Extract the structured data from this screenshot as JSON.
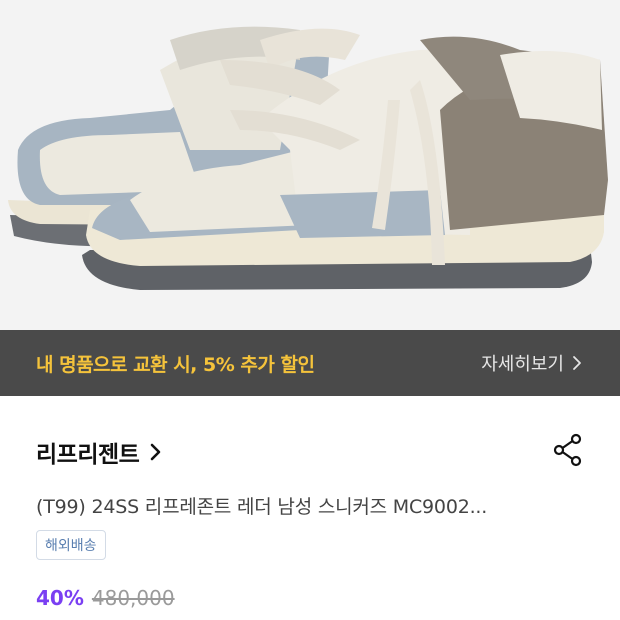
{
  "promo": {
    "text": "내 명품으로 교환 시, 5% 추가 할인",
    "more_label": "자세히보기",
    "text_color": "#f5c33b",
    "background": "#4a4a4a"
  },
  "brand": {
    "name": "리프리젠트"
  },
  "product": {
    "title": "(T99) 24SS 리프레존트 레더 남성 스니커즈 MC9002...",
    "shipping_badge": "해외배송",
    "discount": "40%",
    "original_price": "480,000"
  },
  "colors": {
    "discount": "#7a3ff2",
    "badge_text": "#5a7fb0"
  },
  "icons": {
    "promo_chevron": "chevron-right-icon",
    "brand_chevron": "chevron-right-icon",
    "share": "share-icon"
  }
}
